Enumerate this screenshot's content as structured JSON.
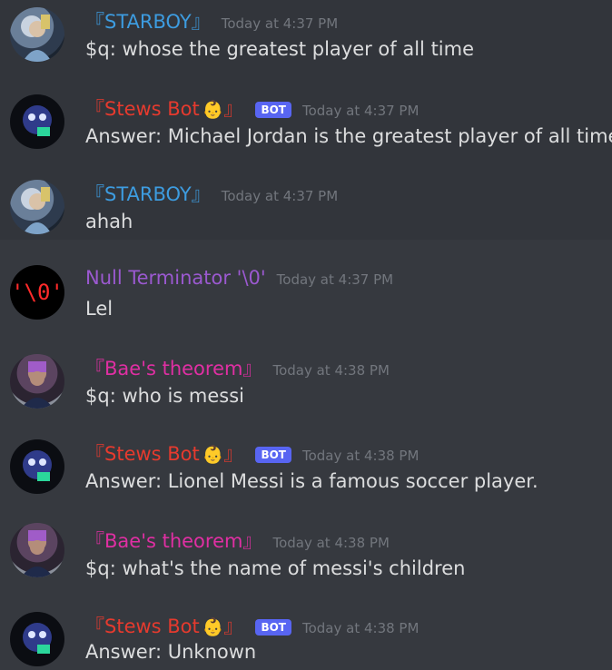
{
  "messages": [
    {
      "author": "『STARBOY』",
      "author_color": "#3d9ce0",
      "time": "Today at 4:37 PM",
      "text": "$q: whose the greatest player of all time",
      "avatar": "starboy-avatar",
      "bot": false,
      "highlight": true
    },
    {
      "author": "『Stews Bot",
      "author_close": "』",
      "emoji": "👶",
      "author_color": "#e63a2e",
      "bot_tag": "BOT",
      "time": "Today at 4:37 PM",
      "text": "Answer:  Michael Jordan is the greatest player of all time.",
      "avatar": "bot-avatar",
      "bot": true,
      "highlight": true
    },
    {
      "author": "『STARBOY』",
      "author_color": "#3d9ce0",
      "time": "Today at 4:37 PM",
      "text": "ahah",
      "avatar": "starboy-avatar",
      "bot": false,
      "highlight": true
    },
    {
      "author": "Null Terminator '\\0'",
      "author_color": "#9b59d0",
      "time": "Today at 4:37 PM",
      "text": "Lel",
      "avatar": "null-avatar",
      "avatar_text": "'\\0'",
      "bot": false,
      "highlight": false
    },
    {
      "author": "『Bae's theorem』",
      "author_color": "#e02fa3",
      "time": "Today at 4:38 PM",
      "text": "$q: who is messi",
      "avatar": "bae-avatar",
      "bot": false,
      "highlight": false
    },
    {
      "author": "『Stews Bot",
      "author_close": "』",
      "emoji": "👶",
      "author_color": "#e63a2e",
      "bot_tag": "BOT",
      "time": "Today at 4:38 PM",
      "text": "Answer:  Lionel Messi is a famous soccer player.",
      "avatar": "bot-avatar",
      "bot": true,
      "highlight": false
    },
    {
      "author": "『Bae's theorem』",
      "author_color": "#e02fa3",
      "time": "Today at 4:38 PM",
      "text": "$q: what's the name of messi's children",
      "avatar": "bae-avatar",
      "bot": false,
      "highlight": false
    },
    {
      "author": "『Stews Bot",
      "author_close": "』",
      "emoji": "👶",
      "author_color": "#e63a2e",
      "bot_tag": "BOT",
      "time": "Today at 4:38 PM",
      "text": "Answer:  Unknown",
      "avatar": "bot-avatar",
      "bot": true,
      "highlight": false
    }
  ],
  "colors": {
    "background": "#36393f",
    "highlight_background": "#32353b",
    "timestamp": "#72767d",
    "message_text": "#dcddde",
    "bot_tag_bg": "#5865f2"
  }
}
